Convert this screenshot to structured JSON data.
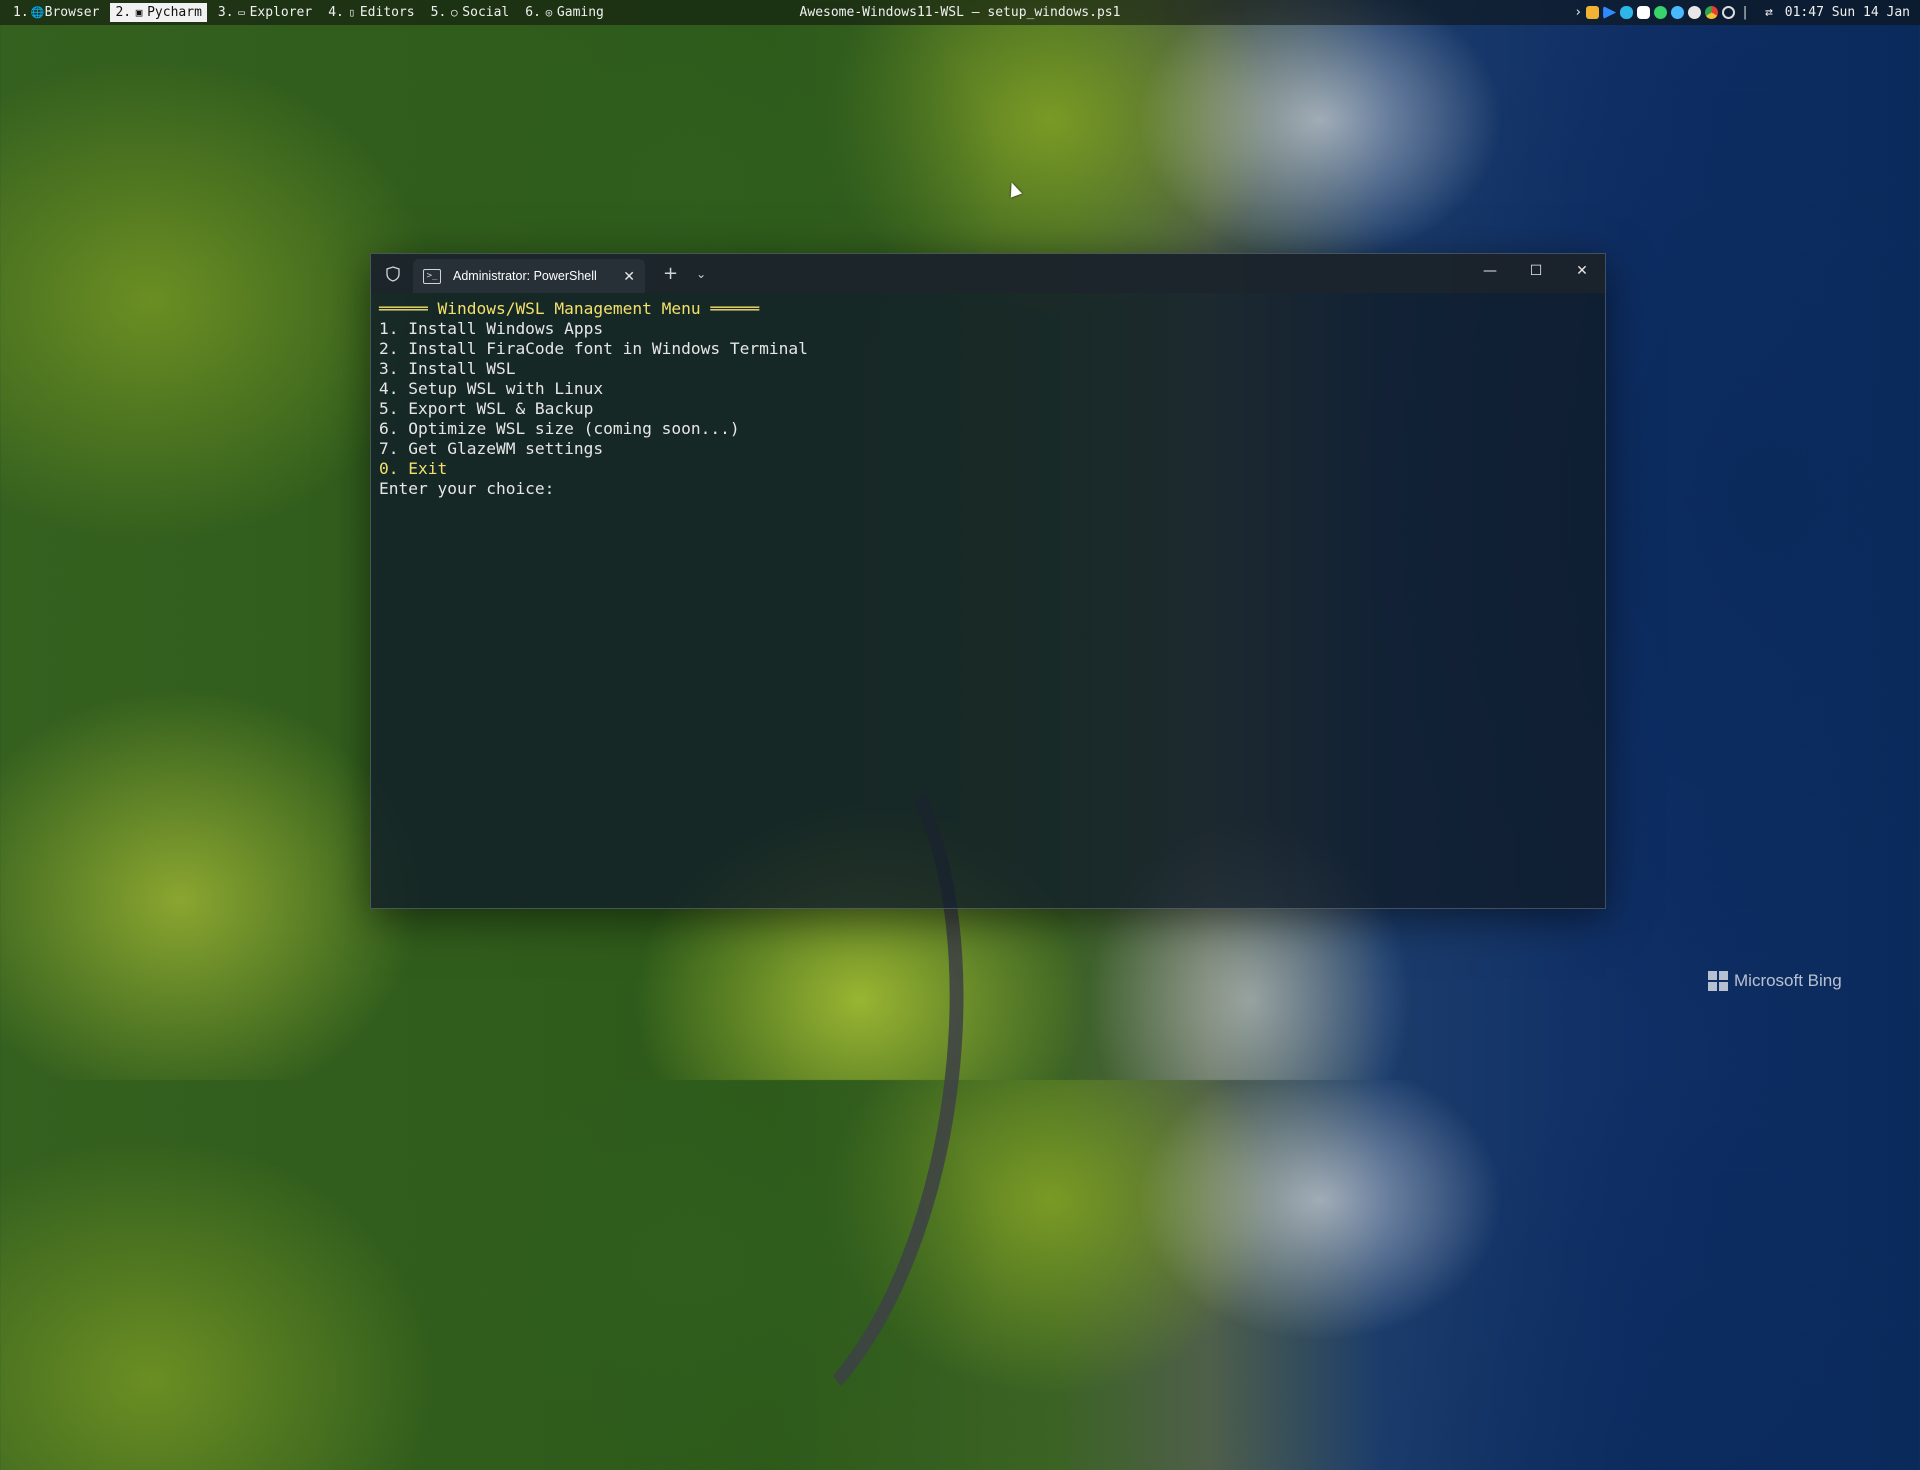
{
  "topbar": {
    "workspaces": [
      {
        "num": "1.",
        "icon": "globe-icon",
        "glyph": "🌐",
        "label": "Browser",
        "active": false
      },
      {
        "num": "2.",
        "icon": "monitor-icon",
        "glyph": "▣",
        "label": "Pycharm",
        "active": true
      },
      {
        "num": "3.",
        "icon": "folder-icon",
        "glyph": "▭",
        "label": "Explorer",
        "active": false
      },
      {
        "num": "4.",
        "icon": "document-icon",
        "glyph": "▯",
        "label": "Editors",
        "active": false
      },
      {
        "num": "5.",
        "icon": "chat-bubble-icon",
        "glyph": "○",
        "label": "Social",
        "active": false
      },
      {
        "num": "6.",
        "icon": "gamepad-icon",
        "glyph": "◎",
        "label": "Gaming",
        "active": false
      }
    ],
    "window_title": "Awesome-Windows11-WSL – setup_windows.ps1",
    "tray": {
      "chevron": "›",
      "icons": [
        {
          "name": "app-grid-icon",
          "color": "#f2b233"
        },
        {
          "name": "play-icon",
          "color": "#2e8bff"
        },
        {
          "name": "cloud-icon",
          "color": "#2fb6e8"
        },
        {
          "name": "discord-icon",
          "color": "#ffffff"
        },
        {
          "name": "whatsapp-icon",
          "color": "#38d36b"
        },
        {
          "name": "globe-circle-icon",
          "color": "#4ab8ff"
        },
        {
          "name": "steam-icon",
          "color": "#e8e8e8"
        },
        {
          "name": "chrome-icon",
          "color": "#e34133"
        },
        {
          "name": "link-icon",
          "color": "#dddddd"
        }
      ],
      "separator": "|",
      "network_glyph": "⇄",
      "clock": "01:47 Sun 14 Jan"
    }
  },
  "terminal": {
    "tab_title": "Administrator: PowerShell",
    "tab_close": "✕",
    "new_tab": "+",
    "dropdown": "⌄",
    "controls": {
      "minimize": "—",
      "maximize": "☐",
      "close": "✕"
    },
    "lines": {
      "header": "═════ Windows/WSL Management Menu ═════",
      "l1": "1. Install Windows Apps",
      "l2": "2. Install FiraCode font in Windows Terminal",
      "l3": "3. Install WSL",
      "l4": "4. Setup WSL with Linux",
      "l5": "5. Export WSL & Backup",
      "l6": "6. Optimize WSL size (coming soon...)",
      "l7": "7. Get GlazeWM settings",
      "l0": "0. Exit",
      "prompt": "Enter your choice: "
    },
    "colors": {
      "header": "#f3e06b",
      "text": "#e6e6e6"
    }
  },
  "watermark": {
    "text": "Microsoft Bing"
  }
}
